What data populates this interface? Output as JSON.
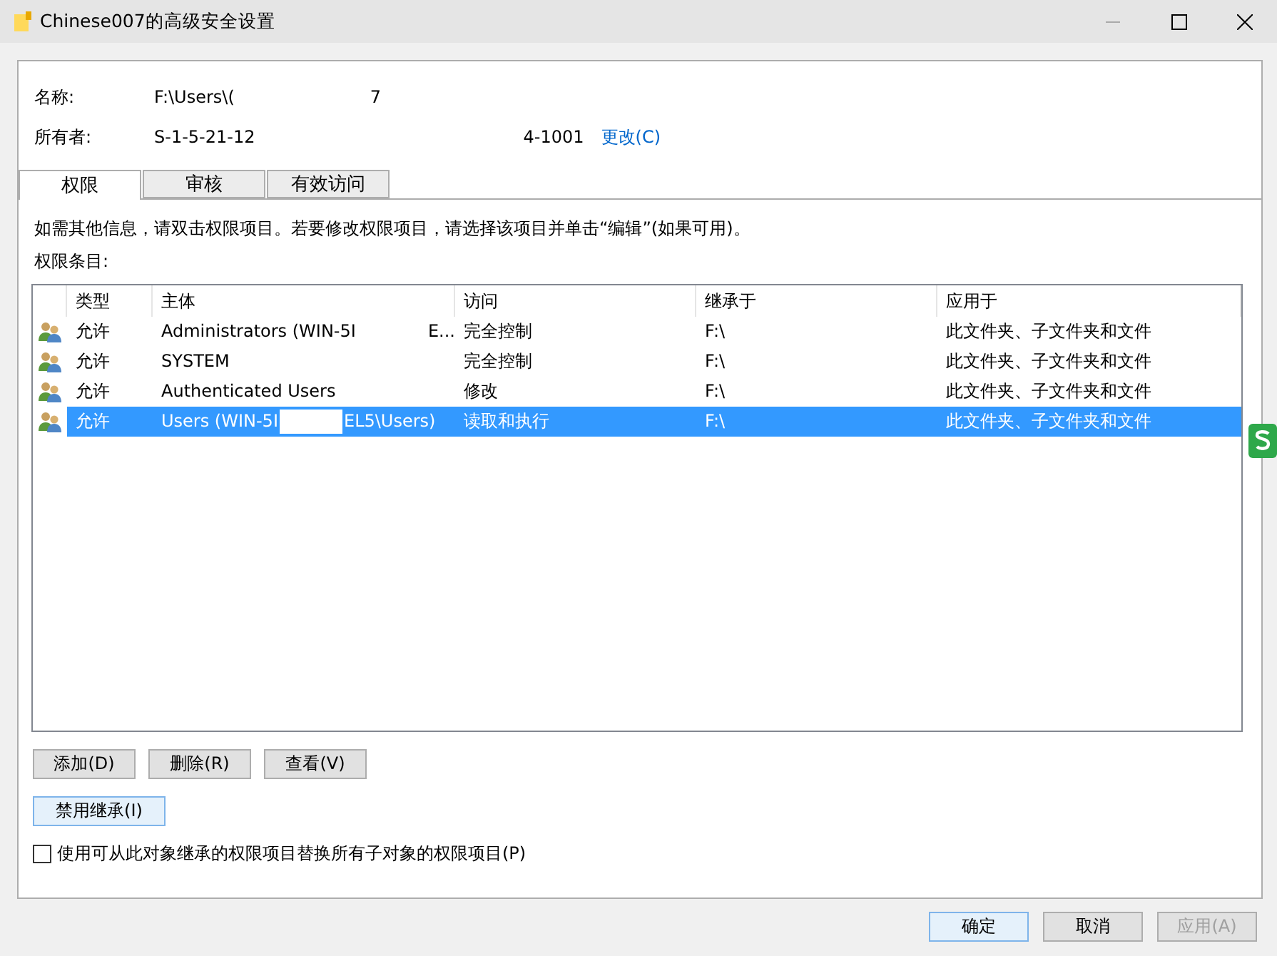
{
  "window": {
    "title": "Chinese007的高级安全设置"
  },
  "name_field": {
    "label": "名称:",
    "value_parts": [
      "F:\\Users\\(",
      "7"
    ]
  },
  "owner_field": {
    "label": "所有者:",
    "value_parts": [
      "S-1-5-21-12",
      "4-1001"
    ],
    "change_link": "更改(C)"
  },
  "tabs": [
    {
      "label": "权限",
      "selected": true
    },
    {
      "label": "审核",
      "selected": false
    },
    {
      "label": "有效访问",
      "selected": false
    }
  ],
  "info_text": "如需其他信息，请双击权限项目。若要修改权限项目，请选择该项目并单击“编辑”(如果可用)。",
  "entries_label": "权限条目:",
  "table": {
    "columns": [
      "类型",
      "主体",
      "访问",
      "继承于",
      "应用于"
    ],
    "rows": [
      {
        "type": "允许",
        "principal_parts": [
          "Administrators (WIN-5I",
          "E..."
        ],
        "access": "完全控制",
        "inherited_from": "F:\\",
        "applies_to": "此文件夹、子文件夹和文件",
        "selected": false
      },
      {
        "type": "允许",
        "principal_parts": [
          "SYSTEM"
        ],
        "access": "完全控制",
        "inherited_from": "F:\\",
        "applies_to": "此文件夹、子文件夹和文件",
        "selected": false
      },
      {
        "type": "允许",
        "principal_parts": [
          "Authenticated Users"
        ],
        "access": "修改",
        "inherited_from": "F:\\",
        "applies_to": "此文件夹、子文件夹和文件",
        "selected": false
      },
      {
        "type": "允许",
        "principal_parts": [
          "Users (WIN-5I",
          "EL5\\Users)"
        ],
        "redacted": true,
        "access": "读取和执行",
        "inherited_from": "F:\\",
        "applies_to": "此文件夹、子文件夹和文件",
        "selected": true
      }
    ]
  },
  "entry_buttons": [
    "添加(D)",
    "删除(R)",
    "查看(V)"
  ],
  "inherit_button": "禁用继承(I)",
  "replace_checkbox": {
    "label": "使用可从此对象继承的权限项目替换所有子对象的权限项目(P)",
    "checked": false
  },
  "dialog_buttons": [
    {
      "label": "确定",
      "disabled": false,
      "focused": true
    },
    {
      "label": "取消",
      "disabled": false,
      "focused": false
    },
    {
      "label": "应用(A)",
      "disabled": true,
      "focused": false
    }
  ]
}
